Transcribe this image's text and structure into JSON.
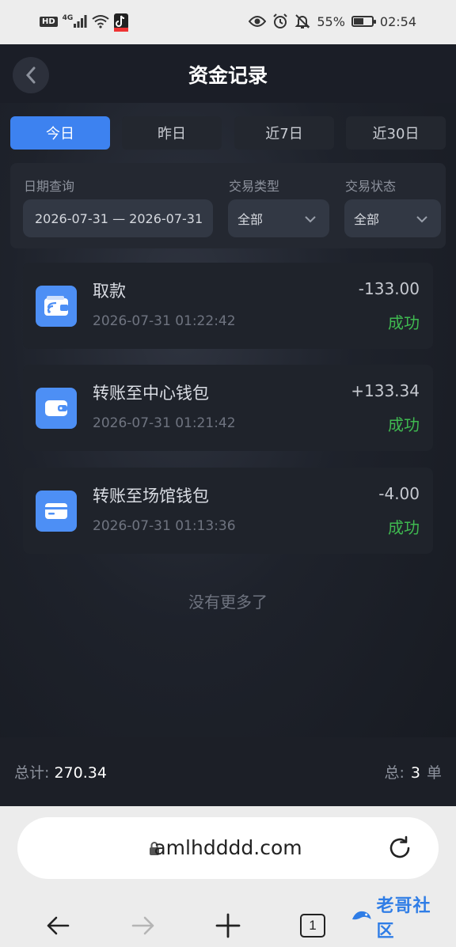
{
  "status_bar": {
    "network_badge": "HD",
    "network_type": "4G",
    "battery_percent": "55%",
    "battery_level": 0.55,
    "time": "02:54"
  },
  "header": {
    "title": "资金记录"
  },
  "tabs": [
    {
      "label": "今日",
      "active": true
    },
    {
      "label": "昨日",
      "active": false
    },
    {
      "label": "近7日",
      "active": false
    },
    {
      "label": "近30日",
      "active": false
    }
  ],
  "filter": {
    "date_label": "日期查询",
    "date_range": "2026-07-31 — 2026-07-31",
    "type_label": "交易类型",
    "type_value": "全部",
    "status_label": "交易状态",
    "status_value": "全部"
  },
  "records": [
    {
      "title": "取款",
      "time": "2026-07-31 01:22:42",
      "amount": "-133.00",
      "status": "成功",
      "icon": "wallet-cards-icon"
    },
    {
      "title": "转账至中心钱包",
      "time": "2026-07-31 01:21:42",
      "amount": "+133.34",
      "status": "成功",
      "icon": "wallet-icon"
    },
    {
      "title": "转账至场馆钱包",
      "time": "2026-07-31 01:13:36",
      "amount": "-4.00",
      "status": "成功",
      "icon": "card-icon"
    }
  ],
  "no_more": "没有更多了",
  "footer": {
    "total_label": "总计:",
    "total_value": "270.34",
    "count_label": "总:",
    "count_value": "3",
    "count_unit": "单"
  },
  "browser": {
    "url": "amlhdddd.com",
    "tab_count": "1",
    "watermark_text": "老哥社区"
  },
  "colors": {
    "accent": "#3d82f0",
    "success": "#3fb950",
    "icon_bg": "#4d8ff5"
  }
}
